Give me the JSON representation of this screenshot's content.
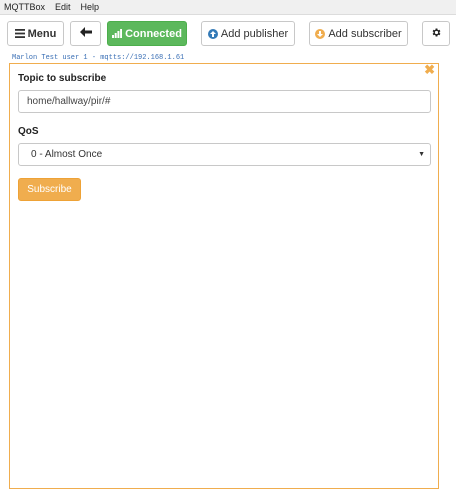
{
  "menubar": {
    "items": [
      "MQTTBox",
      "Edit",
      "Help"
    ]
  },
  "toolbar": {
    "menu_label": "Menu",
    "connected_label": "Connected",
    "add_publisher_label": "Add publisher",
    "add_subscriber_label": "Add subscriber"
  },
  "connection": {
    "label": "Marlon Test user 1 - mqtts://192.168.1.61"
  },
  "subscriber": {
    "topic_label": "Topic to subscribe",
    "topic_value": "home/hallway/pir/#",
    "qos_label": "QoS",
    "qos_selected": "0 - Almost Once",
    "subscribe_label": "Subscribe"
  },
  "icons": {
    "menu": "hamburger-icon",
    "back": "arrow-left-icon",
    "connected": "signal-bars-icon",
    "publisher": "arrow-up-circle-icon",
    "subscriber": "arrow-down-circle-icon",
    "settings": "gear-icon",
    "close": "close-icon"
  },
  "colors": {
    "connected": "#5cb85c",
    "accent": "#f0ad4e",
    "publisher_icon": "#337ab7",
    "subscriber_icon": "#f0ad4e"
  }
}
